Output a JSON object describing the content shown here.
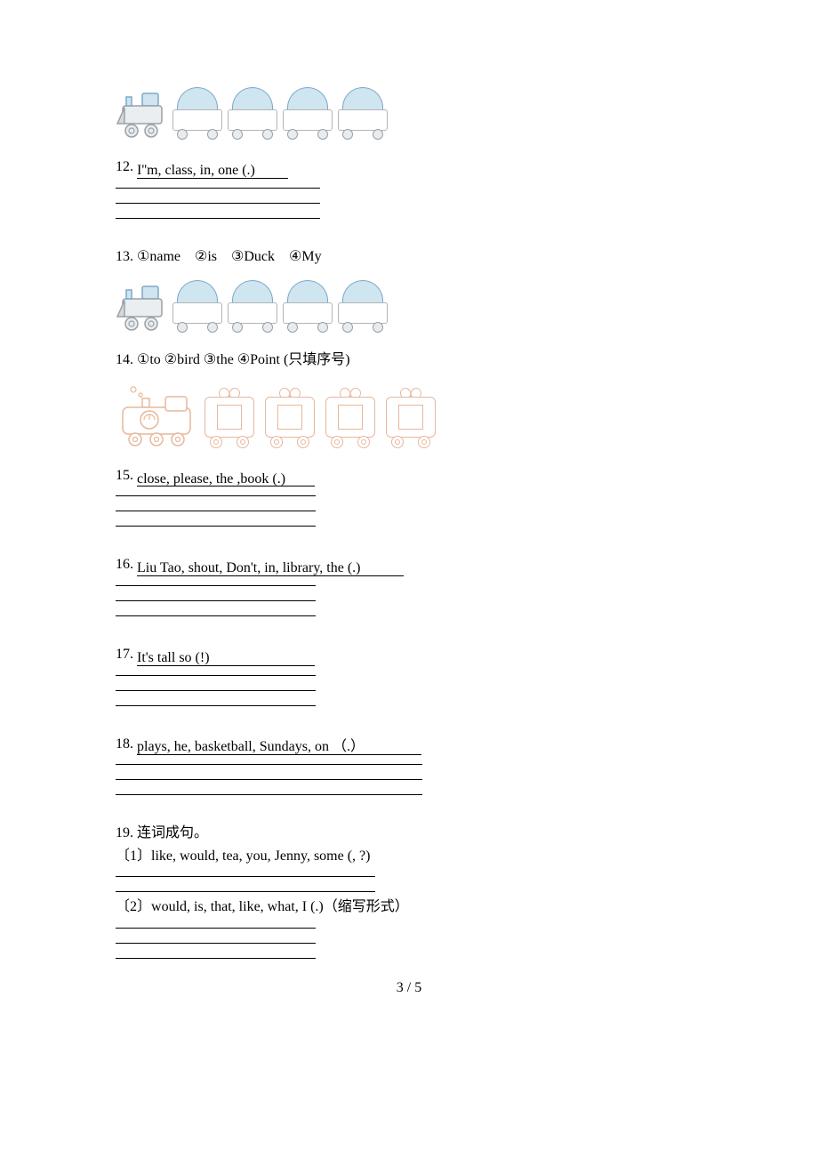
{
  "q11": {
    "image_alt": "train with four cars (blue)"
  },
  "q12": {
    "number": "12.",
    "prompt": "I''m, class, in, one (.)"
  },
  "q13": {
    "number": "13.",
    "opt1_num": "①",
    "opt1_text": "name",
    "opt2_num": "②",
    "opt2_text": "is",
    "opt3_num": "③",
    "opt3_text": "Duck",
    "opt4_num": "④",
    "opt4_text": "My"
  },
  "q14": {
    "number": "14.",
    "opt1_num": "①",
    "opt1_text": "to",
    "opt2_num": "②",
    "opt2_text": "bird",
    "opt3_num": "③",
    "opt3_text": "the",
    "opt4_num": "④",
    "opt4_text": "Point",
    "note": "  (只填序号)"
  },
  "q15": {
    "number": "15.",
    "prompt": "close, please, the ,book (.)"
  },
  "q16": {
    "number": "16.",
    "prompt": "Liu Tao, shout, Don't, in, library, the (.)"
  },
  "q17": {
    "number": "17.",
    "prompt": "It's tall   so   (!)"
  },
  "q18": {
    "number": "18.",
    "prompt": "plays,  he,  basketball,  Sundays, on  （.）"
  },
  "q19": {
    "number": "19.",
    "title": "连词成句。",
    "sub1_num": "〔1〕",
    "sub1_text": "like, would, tea, you, Jenny, some (, ?)",
    "sub2_num": "〔2〕",
    "sub2_text": "would, is, that, like, what, I (.)",
    "sub2_note": "（缩写形式）"
  },
  "page": {
    "num": "3 / 5"
  }
}
